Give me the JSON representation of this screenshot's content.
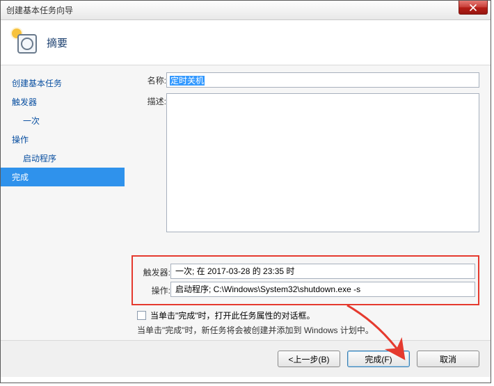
{
  "window": {
    "title": "创建基本任务向导"
  },
  "header": {
    "title": "摘要"
  },
  "sidebar": {
    "items": [
      {
        "label": "创建基本任务",
        "indent": false,
        "selected": false
      },
      {
        "label": "触发器",
        "indent": false,
        "selected": false
      },
      {
        "label": "一次",
        "indent": true,
        "selected": false
      },
      {
        "label": "操作",
        "indent": false,
        "selected": false
      },
      {
        "label": "启动程序",
        "indent": true,
        "selected": false
      },
      {
        "label": "完成",
        "indent": false,
        "selected": true
      }
    ]
  },
  "fields": {
    "name_label": "名称:",
    "name_value": "定时关机",
    "desc_label": "描述:",
    "desc_value": ""
  },
  "summary": {
    "trigger_label": "触发器:",
    "trigger_value": "一次; 在 2017-03-28 的 23:35 时",
    "action_label": "操作:",
    "action_value": "启动程序; C:\\Windows\\System32\\shutdown.exe -s"
  },
  "bottom": {
    "checkbox_label": "当单击\"完成\"时，打开此任务属性的对话框。",
    "info_text": "当单击\"完成\"时，新任务将会被创建并添加到 Windows 计划中。"
  },
  "footer": {
    "back": "<上一步(B)",
    "finish": "完成(F)",
    "cancel": "取消"
  }
}
